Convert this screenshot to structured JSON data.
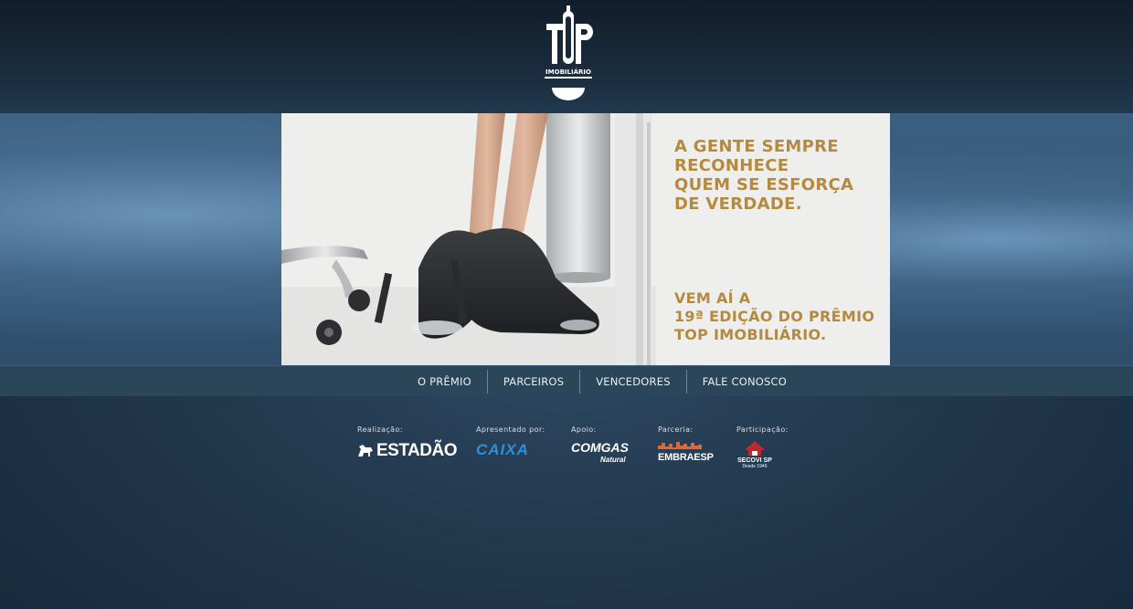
{
  "logo": {
    "line1": "TOP",
    "line2": "IMOBILIÁRIO"
  },
  "hero": {
    "headline": [
      "A GENTE SEMPRE",
      "RECONHECE",
      "QUEM SE ESFORÇA",
      "DE VERDADE."
    ],
    "subline": [
      "VEM AÍ A",
      "19ª EDIÇÃO DO PRÊMIO",
      "TOP IMOBILIÁRIO."
    ]
  },
  "nav": {
    "items": [
      "O PRÊMIO",
      "PARCEIROS",
      "VENCEDORES",
      "FALE CONOSCO"
    ]
  },
  "sponsors": [
    {
      "label": "Realização:",
      "name": "ESTADÃO"
    },
    {
      "label": "Apresentado por:",
      "name": "CAIXA"
    },
    {
      "label": "Apoio:",
      "name": "COMGAS",
      "sub": "Natural"
    },
    {
      "label": "Parceria:",
      "name": "EMBRAESP"
    },
    {
      "label": "Participação:",
      "name": "SECOVI SP",
      "sub": "Desde 1946"
    }
  ],
  "colors": {
    "accent": "#b58a3e",
    "nav_bg": "#2b4559",
    "caixa_blue": "#2d8fd8"
  }
}
